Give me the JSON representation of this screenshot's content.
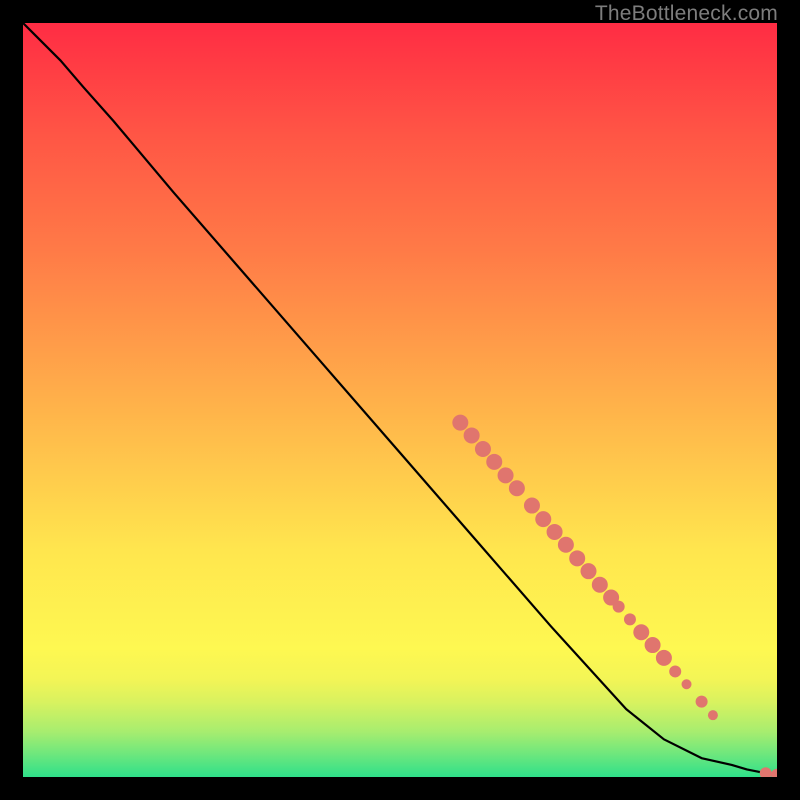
{
  "watermark": "TheBottleneck.com",
  "chart_data": {
    "type": "line",
    "title": "",
    "xlabel": "",
    "ylabel": "",
    "xlim": [
      0,
      100
    ],
    "ylim": [
      0,
      100
    ],
    "grid": false,
    "background": "heatmap-gradient",
    "gradient_stops": [
      {
        "pct": 0,
        "color": "#2fe08a"
      },
      {
        "pct": 3,
        "color": "#6de77d"
      },
      {
        "pct": 6,
        "color": "#a7ed6f"
      },
      {
        "pct": 10,
        "color": "#d9f25f"
      },
      {
        "pct": 13,
        "color": "#f3f556"
      },
      {
        "pct": 17,
        "color": "#fef851"
      },
      {
        "pct": 30,
        "color": "#ffe64e"
      },
      {
        "pct": 50,
        "color": "#ffb04a"
      },
      {
        "pct": 70,
        "color": "#ff7a47"
      },
      {
        "pct": 85,
        "color": "#ff5645"
      },
      {
        "pct": 100,
        "color": "#ff2c44"
      }
    ],
    "series": [
      {
        "name": "curve",
        "color": "#000000",
        "x": [
          0.0,
          2.0,
          5.0,
          8.0,
          12.0,
          20.0,
          30.0,
          40.0,
          50.0,
          60.0,
          70.0,
          80.0,
          85.0,
          90.0,
          94.0,
          96.0,
          97.5,
          98.5,
          99.2,
          100.0
        ],
        "y": [
          100.0,
          98.0,
          95.0,
          91.5,
          87.0,
          77.5,
          66.0,
          54.5,
          43.0,
          31.5,
          20.0,
          9.0,
          5.0,
          2.5,
          1.6,
          1.0,
          0.7,
          0.5,
          0.35,
          0.3
        ]
      }
    ],
    "markers": {
      "name": "highlighted-points",
      "color": "#e0756e",
      "points": [
        {
          "x": 58.0,
          "y": 47.0,
          "r": 8
        },
        {
          "x": 59.5,
          "y": 45.3,
          "r": 8
        },
        {
          "x": 61.0,
          "y": 43.5,
          "r": 8
        },
        {
          "x": 62.5,
          "y": 41.8,
          "r": 8
        },
        {
          "x": 64.0,
          "y": 40.0,
          "r": 8
        },
        {
          "x": 65.5,
          "y": 38.3,
          "r": 8
        },
        {
          "x": 67.5,
          "y": 36.0,
          "r": 8
        },
        {
          "x": 69.0,
          "y": 34.2,
          "r": 8
        },
        {
          "x": 70.5,
          "y": 32.5,
          "r": 8
        },
        {
          "x": 72.0,
          "y": 30.8,
          "r": 8
        },
        {
          "x": 73.5,
          "y": 29.0,
          "r": 8
        },
        {
          "x": 75.0,
          "y": 27.3,
          "r": 8
        },
        {
          "x": 76.5,
          "y": 25.5,
          "r": 8
        },
        {
          "x": 78.0,
          "y": 23.8,
          "r": 8
        },
        {
          "x": 79.0,
          "y": 22.6,
          "r": 6
        },
        {
          "x": 80.5,
          "y": 20.9,
          "r": 6
        },
        {
          "x": 82.0,
          "y": 19.2,
          "r": 8
        },
        {
          "x": 83.5,
          "y": 17.5,
          "r": 8
        },
        {
          "x": 85.0,
          "y": 15.8,
          "r": 8
        },
        {
          "x": 86.5,
          "y": 14.0,
          "r": 6
        },
        {
          "x": 88.0,
          "y": 12.3,
          "r": 5
        },
        {
          "x": 90.0,
          "y": 10.0,
          "r": 6
        },
        {
          "x": 91.5,
          "y": 8.2,
          "r": 5
        },
        {
          "x": 98.5,
          "y": 0.5,
          "r": 6
        },
        {
          "x": 100.0,
          "y": 0.3,
          "r": 6
        }
      ]
    }
  }
}
